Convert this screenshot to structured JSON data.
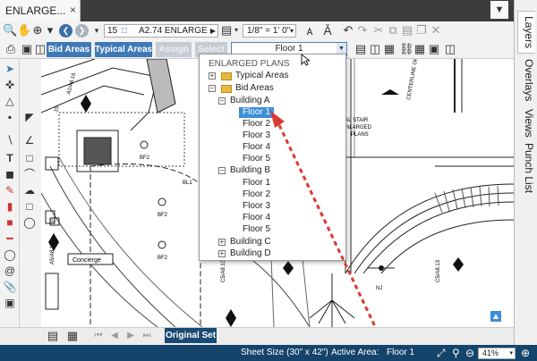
{
  "tab": {
    "title": "ENLARGE...",
    "close": "×",
    "chevron": "▼"
  },
  "toolbar": {
    "page_number": "15",
    "page_name": "A2.74 ENLARGE",
    "scale": "1/8\" = 1' 0\"",
    "buttons": {
      "bid_areas": "Bid Areas",
      "typical_areas": "Typical Areas",
      "assign": "Assign",
      "select": "Select"
    },
    "area_select": "Floor 1"
  },
  "right_tabs": [
    "Layers",
    "Overlays",
    "Views",
    "Punch List"
  ],
  "tree": {
    "root": "ENLARGED PLANS",
    "items": [
      {
        "label": "Typical Areas"
      },
      {
        "label": "Bid Areas"
      },
      {
        "label": "Building A"
      },
      {
        "label": "Floor 1"
      },
      {
        "label": "Floor 2"
      },
      {
        "label": "Floor 3"
      },
      {
        "label": "Floor 4"
      },
      {
        "label": "Floor 5"
      },
      {
        "label": "Building B"
      },
      {
        "label": "Floor 1"
      },
      {
        "label": "Floor 2"
      },
      {
        "label": "Floor 3"
      },
      {
        "label": "Floor 4"
      },
      {
        "label": "Floor 5"
      },
      {
        "label": "Building C"
      },
      {
        "label": "Building D"
      }
    ]
  },
  "bottom": {
    "original_set": "Original Set"
  },
  "status": {
    "sheet_size": "Sheet Size (30\" x 42\")",
    "active_area_label": "Active Area:",
    "active_area_value": "Floor 1",
    "zoom": "41%"
  },
  "plan_labels": {
    "concierge": "Concierge",
    "stair_1": "TAL STAIR",
    "stair_2": "NLARGED",
    "stair_3": "PLANS",
    "centerline": "CENTERLINE OF",
    "bf2_a": "BF2",
    "bf2_b": "BF2",
    "bf2_c": "BF2",
    "bl1": "BL1",
    "nj": "NJ",
    "sec_a1": "A1/A6.15",
    "sec_a2": "A5/A8.13",
    "sec_b1": "C5/A8.13",
    "sec_b2": "C5/A8.13",
    "k1": "15",
    "k2": "2/"
  },
  "colors": {
    "accent": "#3e79b6",
    "status_bar": "#15446b",
    "selected": "#3e8ed6",
    "arrow": "#d93a32"
  }
}
